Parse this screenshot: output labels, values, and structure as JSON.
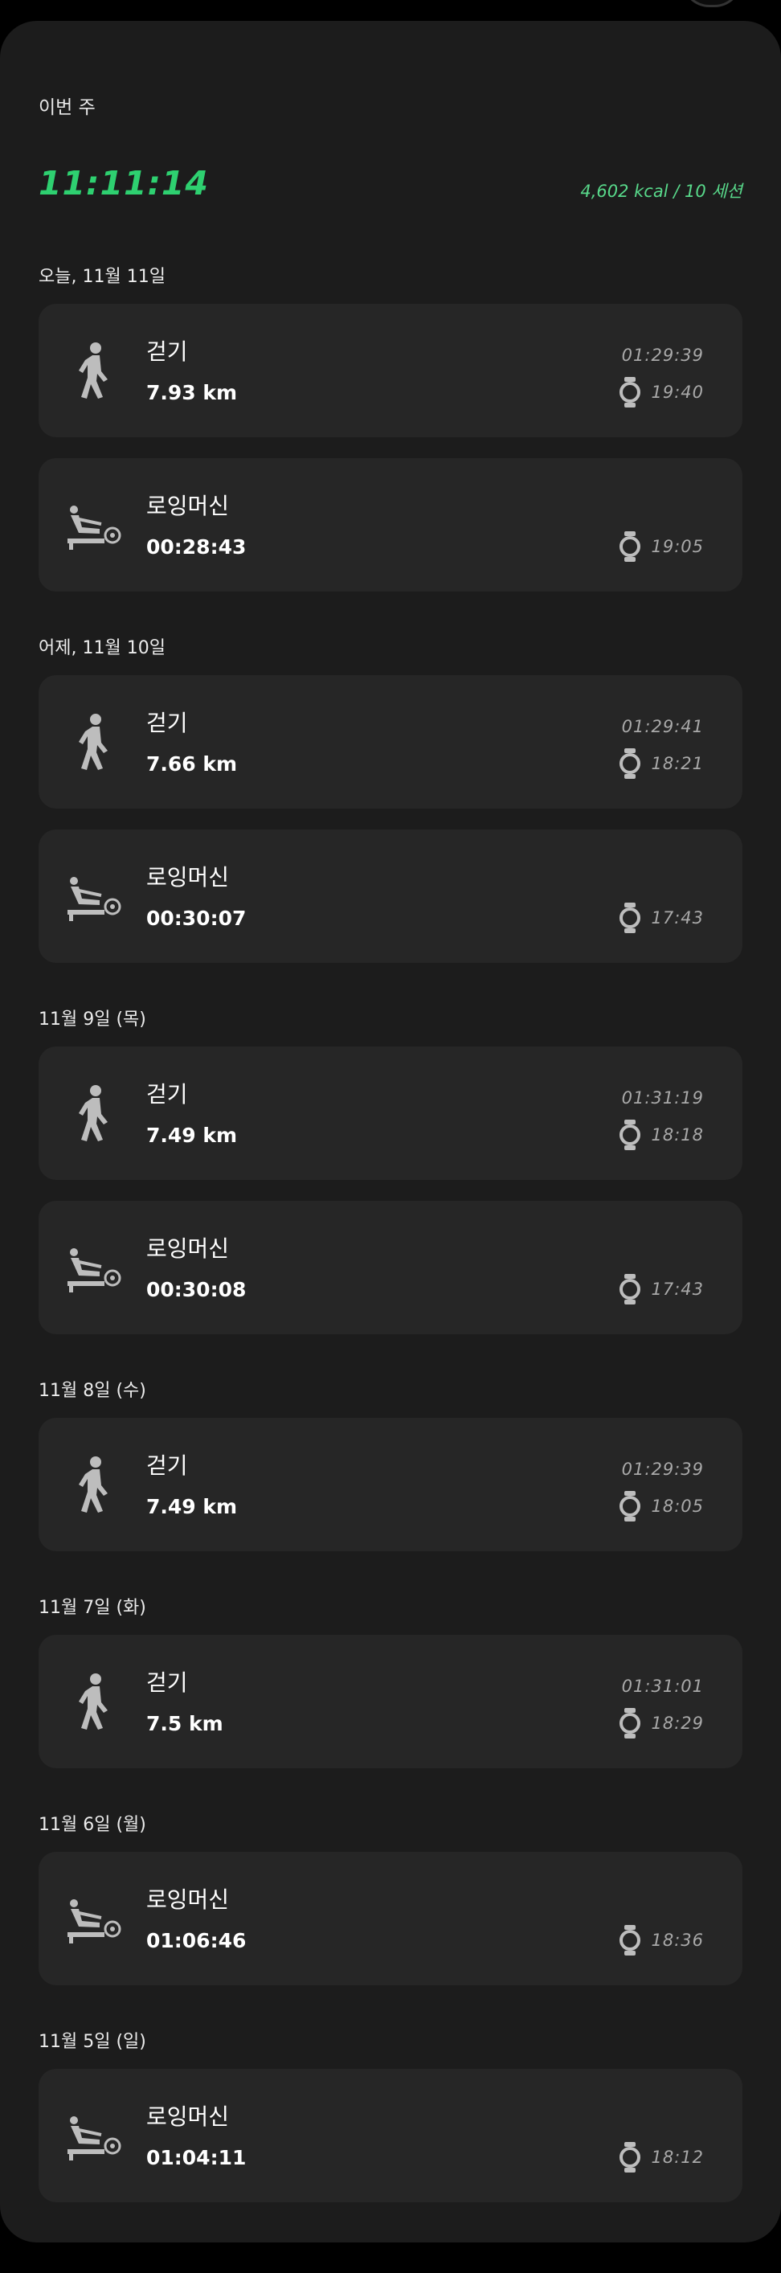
{
  "header": {
    "week_label": "이번 주",
    "total_time": "11:11:14",
    "summary": "4,602 kcal / 10 세션"
  },
  "groups": [
    {
      "date": "오늘, 11월 11일",
      "items": [
        {
          "icon": "walking-icon",
          "name": "걷기",
          "value": "7.93 km",
          "duration": "01:29:39",
          "time": "19:40"
        },
        {
          "icon": "rowing-machine-icon",
          "name": "로잉머신",
          "value": "00:28:43",
          "duration": "",
          "time": "19:05"
        }
      ]
    },
    {
      "date": "어제, 11월 10일",
      "items": [
        {
          "icon": "walking-icon",
          "name": "걷기",
          "value": "7.66 km",
          "duration": "01:29:41",
          "time": "18:21"
        },
        {
          "icon": "rowing-machine-icon",
          "name": "로잉머신",
          "value": "00:30:07",
          "duration": "",
          "time": "17:43"
        }
      ]
    },
    {
      "date": "11월 9일 (목)",
      "items": [
        {
          "icon": "walking-icon",
          "name": "걷기",
          "value": "7.49 km",
          "duration": "01:31:19",
          "time": "18:18"
        },
        {
          "icon": "rowing-machine-icon",
          "name": "로잉머신",
          "value": "00:30:08",
          "duration": "",
          "time": "17:43"
        }
      ]
    },
    {
      "date": "11월 8일 (수)",
      "items": [
        {
          "icon": "walking-icon",
          "name": "걷기",
          "value": "7.49 km",
          "duration": "01:29:39",
          "time": "18:05"
        }
      ]
    },
    {
      "date": "11월 7일 (화)",
      "items": [
        {
          "icon": "walking-icon",
          "name": "걷기",
          "value": "7.5 km",
          "duration": "01:31:01",
          "time": "18:29"
        }
      ]
    },
    {
      "date": "11월 6일 (월)",
      "items": [
        {
          "icon": "rowing-machine-icon",
          "name": "로잉머신",
          "value": "01:06:46",
          "duration": "",
          "time": "18:36"
        }
      ]
    },
    {
      "date": "11월 5일 (일)",
      "items": [
        {
          "icon": "rowing-machine-icon",
          "name": "로잉머신",
          "value": "01:04:11",
          "duration": "",
          "time": "18:12"
        }
      ]
    }
  ],
  "colors": {
    "accent": "#2ed070",
    "summary": "#58d88a",
    "panel": "#1c1c1c",
    "card": "#262626",
    "secondary_text": "#a9a9a9"
  }
}
